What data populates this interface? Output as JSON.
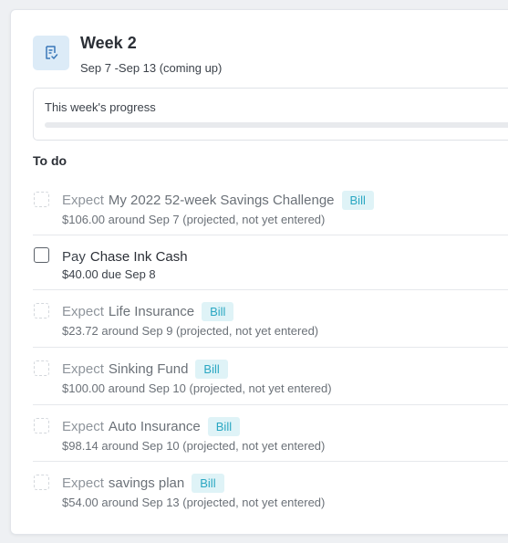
{
  "header": {
    "title": "Week 2",
    "subtitle": "Sep 7 -Sep 13 (coming up)",
    "icon": "receipt-check-icon"
  },
  "progress": {
    "label": "This week's progress",
    "fraction": 0.0
  },
  "todo": {
    "heading": "To do",
    "items": [
      {
        "verb": "Expect",
        "name": "My 2022 52-week Savings Challenge",
        "badge": "Bill",
        "detail": "$106.00 around Sep 7 (projected, not yet entered)",
        "state": "projected"
      },
      {
        "verb": "Pay",
        "name": "Chase Ink Cash",
        "badge": "",
        "detail": "$40.00 due Sep 8",
        "state": "due"
      },
      {
        "verb": "Expect",
        "name": "Life Insurance",
        "badge": "Bill",
        "detail": "$23.72 around Sep 9 (projected, not yet entered)",
        "state": "projected"
      },
      {
        "verb": "Expect",
        "name": "Sinking Fund",
        "badge": "Bill",
        "detail": "$100.00 around Sep 10 (projected, not yet entered)",
        "state": "projected"
      },
      {
        "verb": "Expect",
        "name": "Auto Insurance",
        "badge": "Bill",
        "detail": "$98.14 around Sep 10 (projected, not yet entered)",
        "state": "projected"
      },
      {
        "verb": "Expect",
        "name": "savings plan",
        "badge": "Bill",
        "detail": "$54.00 around Sep 13 (projected, not yet entered)",
        "state": "projected"
      }
    ]
  },
  "colors": {
    "badge_bg": "#dff3f7",
    "badge_text": "#2aa7c2",
    "icon_bg": "#dcebf7",
    "icon_stroke": "#3a78b8"
  }
}
